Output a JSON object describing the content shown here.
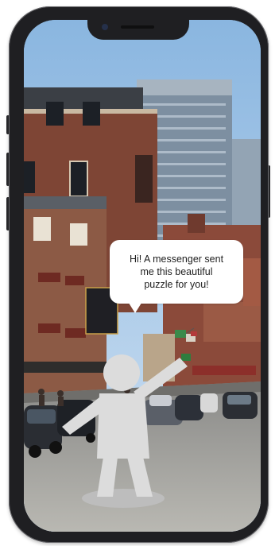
{
  "speech_bubble": {
    "text": "Hi! A messenger sent\nme this beautiful\npuzzle for you!"
  },
  "icons": {
    "camera": "front-camera-icon",
    "speaker": "earpiece-speaker-icon"
  },
  "colors": {
    "frame": "#1f1f22",
    "bubble": "#ffffff",
    "sky": "#9fc3e6",
    "figure": "#d9d9d9"
  }
}
